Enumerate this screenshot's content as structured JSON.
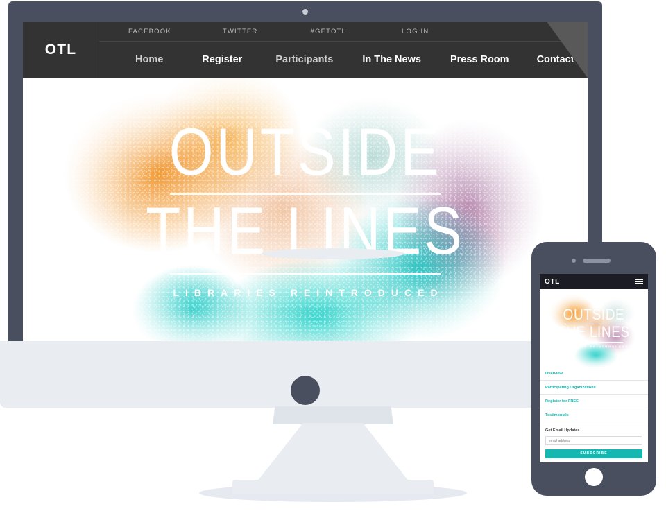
{
  "desktop": {
    "brand": "OTL",
    "utility_links": [
      {
        "label": "FACEBOOK"
      },
      {
        "label": "TWITTER"
      },
      {
        "label": "#GETOTL"
      },
      {
        "label": "LOG IN"
      }
    ],
    "nav_links": [
      {
        "label": "Home"
      },
      {
        "label": "Register"
      },
      {
        "label": "Participants"
      },
      {
        "label": "In The News"
      },
      {
        "label": "Press Room"
      },
      {
        "label": "Contact Us"
      }
    ],
    "hero": {
      "line1": "OUTSIDE",
      "line2": "THE LINES",
      "tagline": "LIBRARIES REINTRODUCED"
    }
  },
  "mobile": {
    "brand": "OTL",
    "menu_icon": "hamburger-icon",
    "hero": {
      "line1": "OUTSIDE",
      "line2": "THE LINES",
      "tagline": "LIBRARIES REINTRODUCED"
    },
    "links": [
      {
        "label": "Overview"
      },
      {
        "label": "Participating Organizations"
      },
      {
        "label": "Register for FREE"
      },
      {
        "label": "Testimonials"
      }
    ],
    "signup": {
      "title": "Get Email Updates",
      "email_value": "",
      "email_placeholder": "email address",
      "button_label": "SUBSCRIBE"
    }
  },
  "colors": {
    "nav_dark": "#333333",
    "device_body": "#4a4f60",
    "device_chin": "#e9ecf1",
    "mobile_header": "#1c1c24",
    "accent_teal": "#14b8b0",
    "spray_orange": "#f08c19",
    "spray_purple": "#8c4682"
  }
}
